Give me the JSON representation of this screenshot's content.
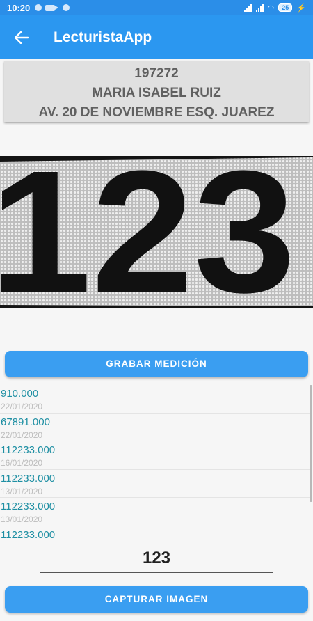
{
  "status_bar": {
    "time": "10:20",
    "battery": "25"
  },
  "app_bar": {
    "title": "LecturistaApp"
  },
  "customer": {
    "account": "197272",
    "name": "MARIA ISABEL RUIZ",
    "address": "AV. 20 DE NOVIEMBRE ESQ. JUAREZ"
  },
  "photo": {
    "digits": "123"
  },
  "buttons": {
    "grabar": "GRABAR MEDICIÓN",
    "capturar": "CAPTURAR IMAGEN"
  },
  "history": [
    {
      "value": "910.000",
      "date": "22/01/2020"
    },
    {
      "value": "67891.000",
      "date": "22/01/2020"
    },
    {
      "value": "112233.000",
      "date": "16/01/2020"
    },
    {
      "value": "112233.000",
      "date": "13/01/2020"
    },
    {
      "value": "112233.000",
      "date": "13/01/2020"
    },
    {
      "value": "112233.000",
      "date": ""
    }
  ],
  "reading_input": {
    "value": "123"
  },
  "colors": {
    "primary": "#2b97f0",
    "button": "#3a9ef1",
    "history_value": "#1e8fa3"
  }
}
